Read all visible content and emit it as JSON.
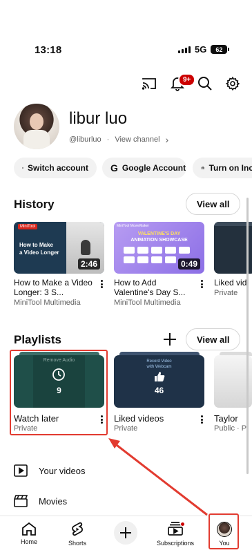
{
  "status_bar": {
    "time": "13:18",
    "network": "5G",
    "battery": "62"
  },
  "header": {
    "icons": [
      "cast-icon",
      "bell-icon",
      "search-icon",
      "gear-icon"
    ],
    "notification_count": "9+"
  },
  "profile": {
    "name": "libur luo",
    "handle": "@liburluo",
    "separator": "·",
    "view_channel": "View channel",
    "chevron": "›"
  },
  "chips": [
    {
      "label": "Switch account",
      "icon": "account-box-icon"
    },
    {
      "label": "Google Account",
      "icon": "google-g-icon"
    },
    {
      "label": "Turn on Inc",
      "icon": "incognito-icon"
    }
  ],
  "history": {
    "title": "History",
    "view_all": "View all",
    "videos": [
      {
        "title": "How to Make a Video Longer: 3 S...",
        "channel": "MiniTool Multimedia",
        "duration": "2:46",
        "thumb_text_line1": "How to Make",
        "thumb_text_line2": "a Video Longer",
        "thumb_brand": "MiniTool"
      },
      {
        "title": "How to Add Valentine's Day S...",
        "channel": "MiniTool Multimedia",
        "duration": "0:49",
        "thumb_text_line1": "VALENTINE'S DAY",
        "thumb_text_line2": "ANIMATION SHOWCASE",
        "thumb_brand": "MiniTool MovieMaker"
      },
      {
        "title": "Liked vid",
        "channel": "Private"
      }
    ]
  },
  "playlists": {
    "title": "Playlists",
    "view_all": "View all",
    "items": [
      {
        "title": "Watch later",
        "privacy": "Private",
        "count": "9",
        "thumb_text": "Remove Audio"
      },
      {
        "title": "Liked videos",
        "privacy": "Private",
        "count": "46",
        "thumb_text_line1": "Record Video",
        "thumb_text_line2": "with Webcam"
      },
      {
        "title": "Taylor",
        "privacy": "Public · Pl"
      }
    ]
  },
  "menu": [
    {
      "label": "Your videos",
      "icon": "play-square-icon"
    },
    {
      "label": "Movies",
      "icon": "clapperboard-icon"
    }
  ],
  "bottom_nav": [
    {
      "label": "Home",
      "icon": "home-icon"
    },
    {
      "label": "Shorts",
      "icon": "shorts-icon"
    },
    {
      "label": "",
      "icon": "plus-icon"
    },
    {
      "label": "Subscriptions",
      "icon": "subscriptions-icon"
    },
    {
      "label": "You",
      "icon": "avatar"
    }
  ],
  "colors": {
    "accent_red": "#cc0000",
    "annotation_red": "#e23b30",
    "chip_bg": "#f2f2f2",
    "muted_text": "#606060"
  }
}
